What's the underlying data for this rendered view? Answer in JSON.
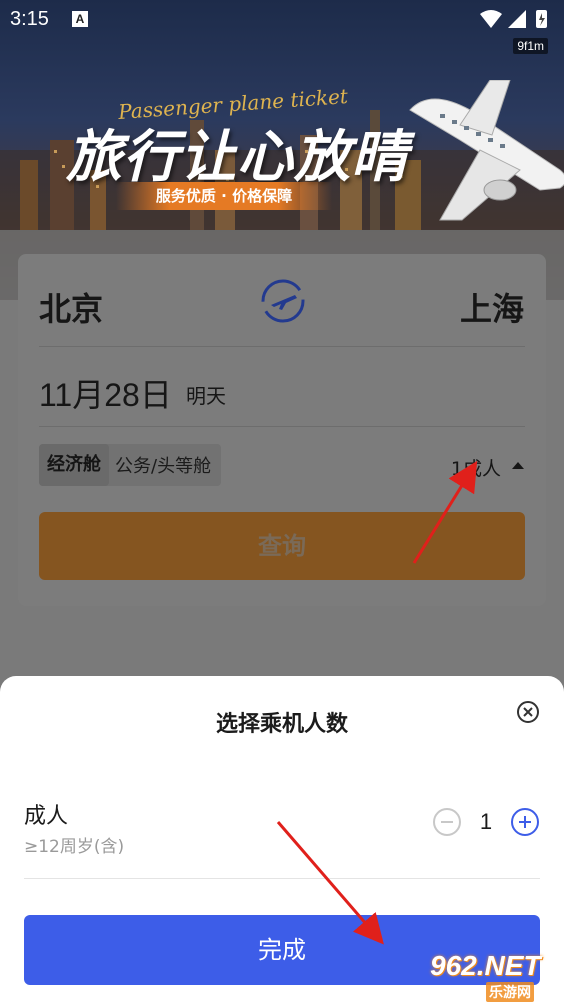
{
  "status_bar": {
    "time": "3:15",
    "notification_glyph": "A",
    "fps": "9f1m"
  },
  "banner": {
    "script": "Passenger plane ticket",
    "headline": "旅行让心放晴",
    "ribbon": "服务优质 · 价格保障"
  },
  "search": {
    "from_city": "北京",
    "to_city": "上海",
    "date": "11月28日",
    "date_note": "明天",
    "cabin_economy": "经济舱",
    "cabin_business": "公务/头等舱",
    "passengers": "1成人",
    "search_label": "查询"
  },
  "sheet": {
    "title": "选择乘机人数",
    "adult_label": "成人",
    "adult_note": "≥12周岁(含)",
    "adult_count": "1",
    "done_label": "完成"
  },
  "watermark": {
    "logo": "962.NET",
    "sub": "乐游网"
  },
  "colors": {
    "primary_blue": "#3d5de8",
    "orange": "#e57a24",
    "annotation_red": "#e0201b"
  }
}
